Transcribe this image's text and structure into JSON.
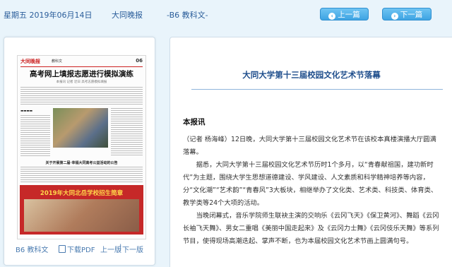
{
  "header": {
    "date": "星期五 2019年06月14日",
    "paper_name": "大同晚报",
    "page_label": "-B6 教科文-",
    "prev_button": "上一篇",
    "next_button": "下一篇"
  },
  "thumbnail": {
    "masthead": "大同晚报",
    "section": "教科文",
    "page_number": "06",
    "headline": "高考网上填报志愿进行模拟演练",
    "subline": "本报讯 记者 近日 高考志愿模拟填报",
    "wide_headline": "关于开展第二届·幸福大同高考公益活动的公告",
    "ad_title": "2019年大同北岳学校招生简章"
  },
  "footer": {
    "page_link": "B6 教科文",
    "download_pdf": "下载PDF",
    "prev_page": "上一版",
    "next_page": "下一版"
  },
  "article": {
    "title": "大同大学第十三届校园文化艺术节落幕",
    "lead": "本报讯",
    "p1": "（记者 杨海峰）12日晚，大同大学第十三届校园文化艺术节在该校本真楼演播大厅圆满落幕。",
    "p2": "据悉，大同大学第十三届校园文化艺术节历时1个多月，以“青春献祖国，建功新时代”为主题，围绕大学生思想道德建设、学风建设、人文素质和科学精神培养等内容，分“文化潮”“艺术韵”“青春风”3大板块，相继举办了文化类、艺术类、科技类、体育类、教学类等24个大项的活动。",
    "p3": "当晚闭幕式，音乐学院师生联袂主演的交响乐《云冈飞天》《保卫黄河》、舞蹈《云冈长袖飞天舞》、男女二重唱《美丽中国走起来》及《云冈力士舞》《云冈伎乐天舞》等系列节目，使得现场高潮迭起、掌声不断，也为本届校园文化艺术节画上圆满句号。"
  }
}
